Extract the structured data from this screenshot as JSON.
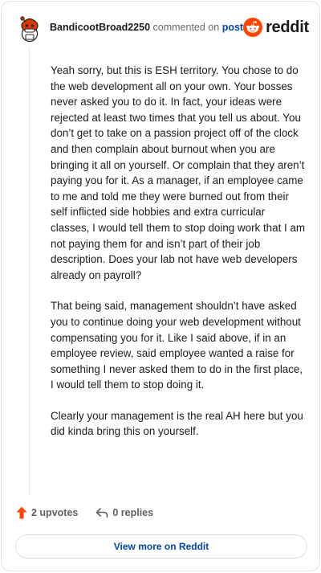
{
  "comment": {
    "author": "BandicootBroad2250",
    "action_text": "commented on",
    "post_link_text": "post",
    "paragraphs": [
      "Yeah sorry, but this is ESH territory. You chose to do the web development all on your own. Your bosses never asked you to do it. In fact, your ideas were rejected at least two times that you tell us about. You don’t get to take on a passion project off of the clock and then complain about burnout when you are bringing it all on yourself. Or complain that they aren’t paying you for it. As a manager, if an employee came to me and told me they were burned out from their self inflicted side hobbies and extra curricular classes, I would tell them to stop doing work that I am not paying them for and isn’t part of their job description. Does your lab not have web developers already on payroll?",
      "That being said, management shouldn’t have asked you to continue doing your web development without compensating you for it. Like I said above, if in an employee review, said employee wanted a raise for something I never asked them to do in the first place, I would tell them to stop doing it.",
      "Clearly your management is the real AH here but you did kinda bring this on yourself."
    ]
  },
  "brand": {
    "wordmark": "reddit",
    "color": "#ff4500"
  },
  "footer": {
    "upvotes_label": "2 upvotes",
    "replies_label": "0 replies"
  },
  "view_more_label": "View more on Reddit",
  "icons": {
    "avatar": "snoo-avatar-icon",
    "logo": "reddit-logo-icon",
    "upvote": "upvote-arrow-icon",
    "reply": "reply-arrow-icon"
  },
  "colors": {
    "link": "#0045ac",
    "upvote": "#ff4500",
    "text": "#1c1c1c",
    "muted": "#6a6a6a"
  }
}
